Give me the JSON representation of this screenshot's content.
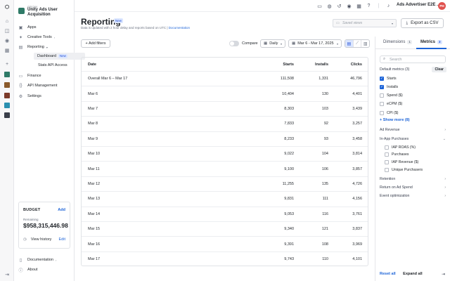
{
  "org": {
    "tag": "GROW",
    "name": "Unity Ads User Acquisition"
  },
  "nav": {
    "apps": "Apps",
    "creative_tools": "Creative Tools",
    "reporting": "Reporting",
    "dashboard": "Dashboard",
    "dashboard_badge": "New",
    "stats_api": "Stats API Access",
    "finance": "Finance",
    "api_management": "API Management",
    "settings": "Settings",
    "documentation": "Documentation",
    "about": "About"
  },
  "budget": {
    "title": "BUDGET",
    "add": "Add",
    "remaining_label": "Remaining",
    "remaining_value": "$958,315,446.98",
    "view_history": "View history",
    "edit": "Edit"
  },
  "header": {
    "account": "Ads Advertiser E2E ...",
    "avatar_initials": "PH"
  },
  "page": {
    "title": "Reporting",
    "title_badge": "New",
    "subtitle_text": "Data is updated with 2 hour delay and reports based on UTC |",
    "subtitle_link": "Documentation",
    "saved_views_placeholder": "Saved views",
    "export_label": "Export as CSV"
  },
  "toolbar": {
    "add_filters": "+ Add filters",
    "compare": "Compare",
    "granularity": "Daily",
    "date_range": "Mar 6 - Mar 17, 2025"
  },
  "table": {
    "headers": [
      "Date",
      "Starts",
      "Installs",
      "Clicks"
    ],
    "rows": [
      [
        "Overall Mar 6 – Mar 17",
        "111,508",
        "1,331",
        "46,796"
      ],
      [
        "Mar 6",
        "10,404",
        "130",
        "4,401"
      ],
      [
        "Mar 7",
        "8,303",
        "103",
        "3,439"
      ],
      [
        "Mar 8",
        "7,833",
        "92",
        "3,257"
      ],
      [
        "Mar 9",
        "8,233",
        "93",
        "3,458"
      ],
      [
        "Mar 10",
        "9,022",
        "104",
        "3,814"
      ],
      [
        "Mar 11",
        "9,100",
        "106",
        "3,857"
      ],
      [
        "Mar 12",
        "11,255",
        "135",
        "4,726"
      ],
      [
        "Mar 13",
        "9,831",
        "111",
        "4,156"
      ],
      [
        "Mar 14",
        "9,053",
        "116",
        "3,761"
      ],
      [
        "Mar 15",
        "9,340",
        "121",
        "3,837"
      ],
      [
        "Mar 16",
        "9,391",
        "108",
        "3,969"
      ],
      [
        "Mar 17",
        "9,743",
        "110",
        "4,101"
      ]
    ]
  },
  "panel": {
    "tab_dimensions": "Dimensions",
    "tab_dimensions_count": "1",
    "tab_metrics": "Metrics",
    "tab_metrics_count": "3",
    "search_placeholder": "Search",
    "default_metrics_label": "Default metrics (3)",
    "clear": "Clear",
    "metrics": [
      {
        "label": "Starts",
        "checked": true
      },
      {
        "label": "Installs",
        "checked": true
      },
      {
        "label": "Spend ($)",
        "checked": false
      },
      {
        "label": "eCPM ($)",
        "checked": false
      },
      {
        "label": "CPI ($)",
        "checked": false
      }
    ],
    "show_more": "+ Show more (8)",
    "ad_revenue": "Ad Revenue",
    "iap": "In-App Purchases",
    "iap_metrics": [
      {
        "label": "IAP ROAS (%)",
        "checked": false
      },
      {
        "label": "Purchases",
        "checked": false
      },
      {
        "label": "IAP Revenue ($)",
        "checked": false
      },
      {
        "label": "Unique Purchasers",
        "checked": false
      }
    ],
    "retention": "Retention",
    "return_on_ad_spend": "Return on Ad Spend",
    "event_optimization": "Event optimization",
    "reset_all": "Reset all",
    "expand_all": "Expand all"
  },
  "colors": {
    "accent": "#1d64d8",
    "brand": "#2f7a67",
    "avatar": "#e0524f"
  }
}
